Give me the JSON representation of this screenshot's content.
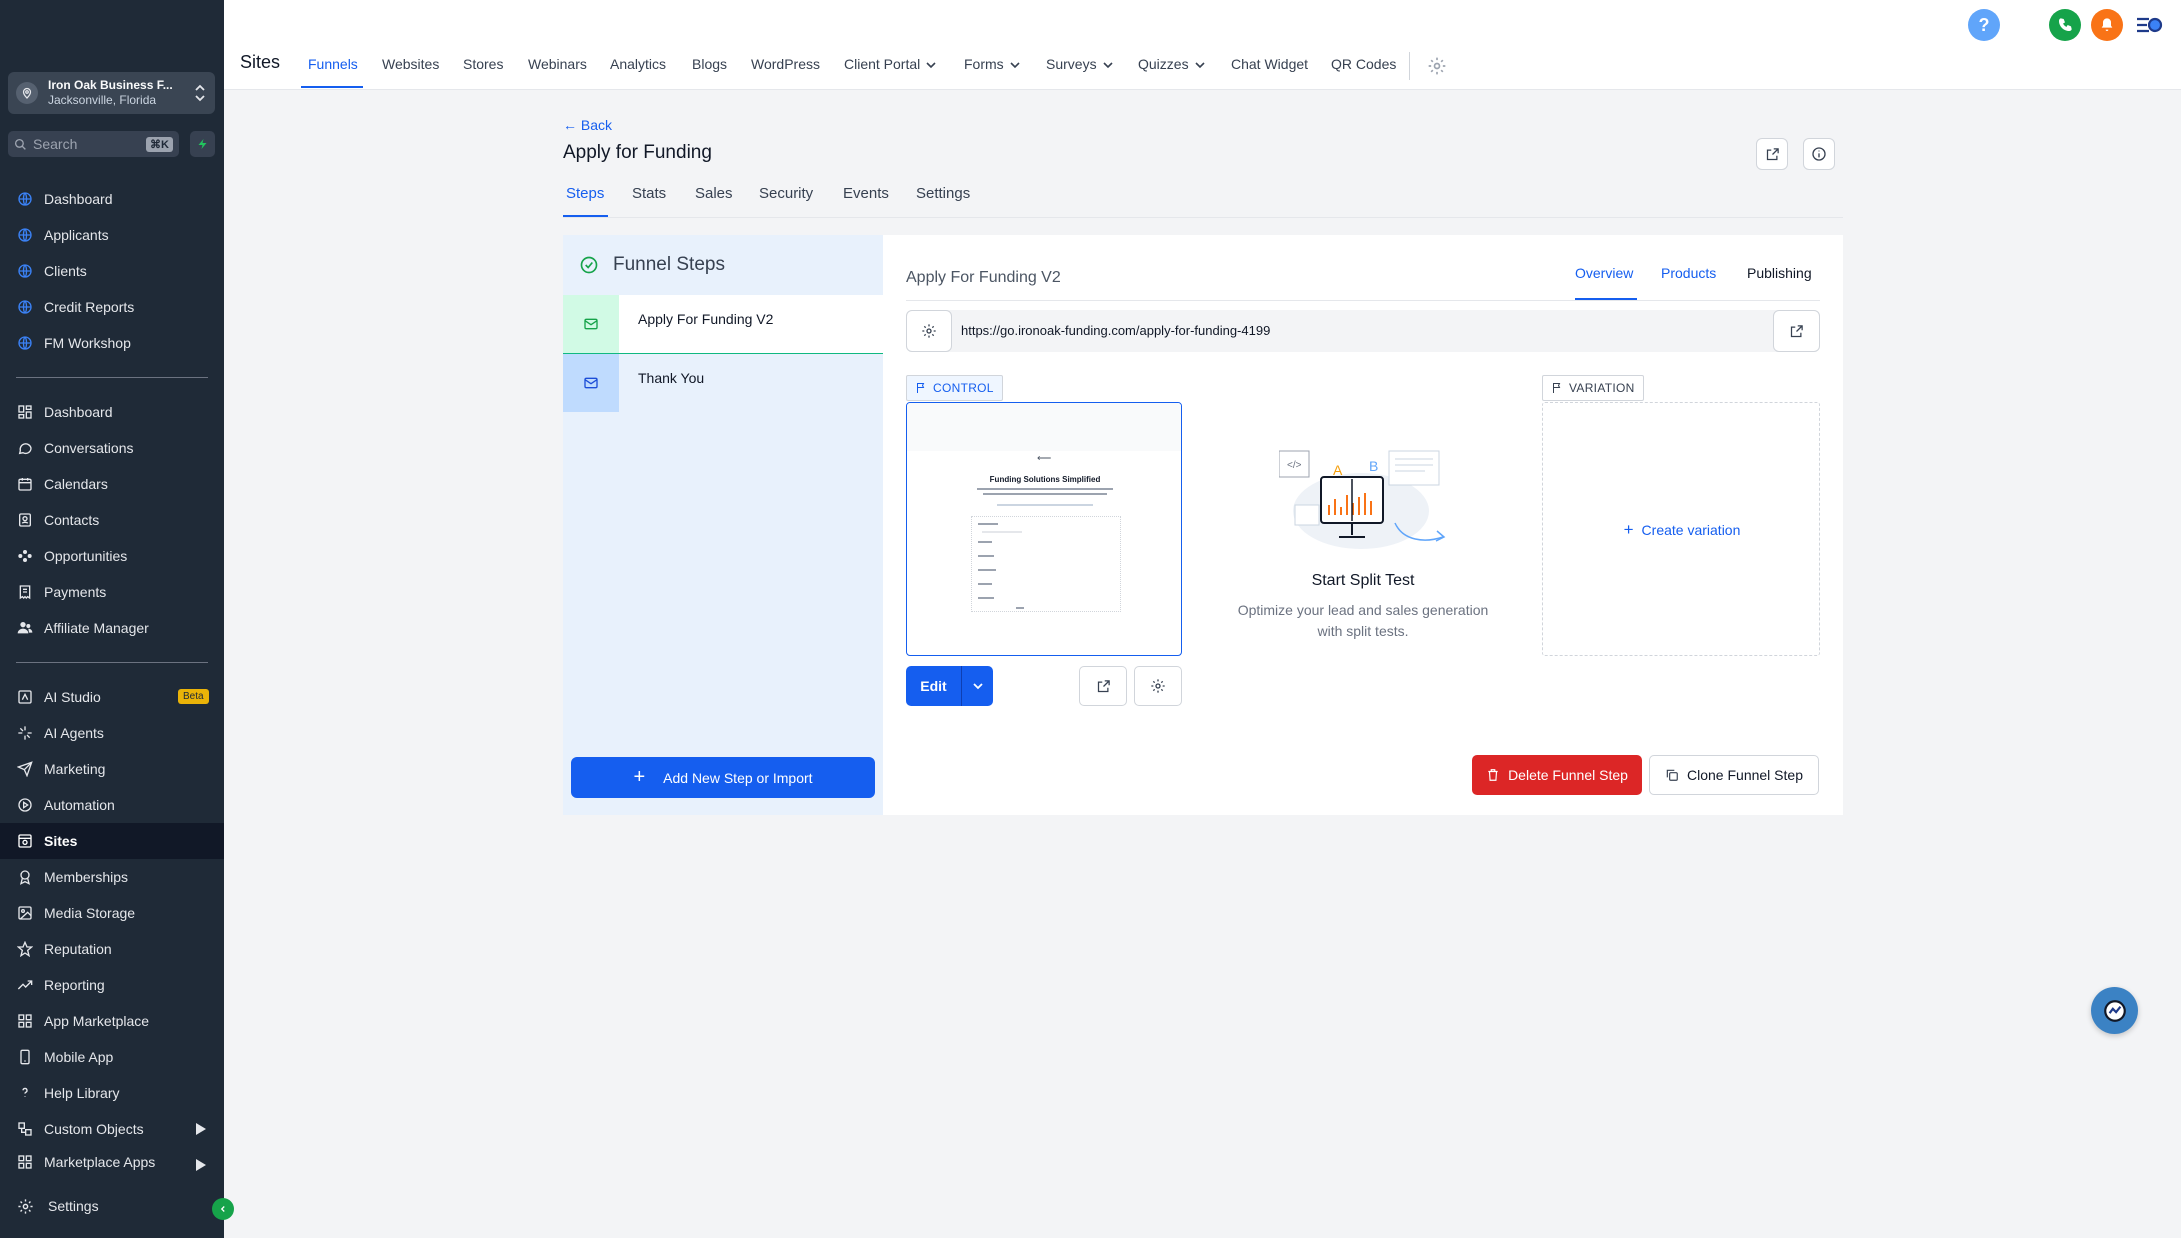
{
  "sidebar": {
    "account": {
      "name": "Iron Oak Business F...",
      "location": "Jacksonville, Florida"
    },
    "search": {
      "placeholder": "Search",
      "shortcut": "⌘K"
    },
    "pinned": [
      {
        "label": "Dashboard",
        "icon": "globe-icon"
      },
      {
        "label": "Applicants",
        "icon": "globe-icon"
      },
      {
        "label": "Clients",
        "icon": "globe-icon"
      },
      {
        "label": "Credit Reports",
        "icon": "globe-icon"
      },
      {
        "label": "FM Workshop",
        "icon": "globe-icon"
      }
    ],
    "main": [
      {
        "label": "Dashboard",
        "icon": "grid-icon"
      },
      {
        "label": "Conversations",
        "icon": "chat-bubble-icon"
      },
      {
        "label": "Calendars",
        "icon": "calendar-icon"
      },
      {
        "label": "Contacts",
        "icon": "contact-card-icon"
      },
      {
        "label": "Opportunities",
        "icon": "opportunities-icon"
      },
      {
        "label": "Payments",
        "icon": "receipt-icon"
      },
      {
        "label": "Affiliate Manager",
        "icon": "users-icon"
      }
    ],
    "tools": [
      {
        "label": "AI Studio",
        "icon": "ai-studio-icon"
      },
      {
        "label": "AI Agents",
        "icon": "sparkle-icon"
      },
      {
        "label": "Marketing",
        "icon": "send-icon"
      },
      {
        "label": "Automation",
        "icon": "automation-icon"
      },
      {
        "label": "Sites",
        "icon": "sites-icon"
      },
      {
        "label": "Memberships",
        "icon": "award-icon"
      },
      {
        "label": "Media Storage",
        "icon": "image-icon"
      },
      {
        "label": "Reputation",
        "icon": "star-icon"
      },
      {
        "label": "Reporting",
        "icon": "trending-icon"
      },
      {
        "label": "App Marketplace",
        "icon": "grid-icon"
      },
      {
        "label": "Mobile App",
        "icon": "mobile-icon"
      },
      {
        "label": "Help Library",
        "icon": "question-icon"
      },
      {
        "label": "Custom Objects",
        "icon": "objects-icon"
      },
      {
        "label": "Marketplace Apps",
        "icon": "grid-icon"
      }
    ],
    "beta_badge": "Beta",
    "settings_label": "Settings",
    "active_item": "Sites"
  },
  "topbar": {
    "title": "Sites",
    "tabs": [
      "Funnels",
      "Websites",
      "Stores",
      "Webinars",
      "Analytics",
      "Blogs",
      "WordPress",
      "Client Portal",
      "Forms",
      "Surveys",
      "Quizzes",
      "Chat Widget",
      "QR Codes"
    ],
    "active_tab": "Funnels",
    "help_glyph": "?"
  },
  "page": {
    "back_label": "Back",
    "title": "Apply for Funding",
    "tabs": [
      "Steps",
      "Stats",
      "Sales",
      "Security",
      "Events",
      "Settings"
    ],
    "active_tab": "Steps"
  },
  "funnel_steps": {
    "heading": "Funnel Steps",
    "steps": [
      {
        "label": "Apply For Funding V2",
        "selected": true
      },
      {
        "label": "Thank You",
        "selected": false
      }
    ],
    "add_button": "Add New Step or Import"
  },
  "step_detail": {
    "title": "Apply For Funding V2",
    "tabs": [
      "Overview",
      "Products",
      "Publishing"
    ],
    "active_tab": "Overview",
    "url": "https://go.ironoak-funding.com/apply-for-funding-4199",
    "control_label": "CONTROL",
    "variation_label": "VARIATION",
    "preview_heading": "Funding Solutions Simplified",
    "edit_label": "Edit",
    "split_test_title": "Start Split Test",
    "split_test_desc": "Optimize your lead and sales generation with split tests.",
    "illustration_letters": {
      "a": "A",
      "b": "B"
    },
    "create_variation": "Create variation",
    "delete_button": "Delete Funnel Step",
    "clone_button": "Clone Funnel Step"
  },
  "colors": {
    "sidebar_bg": "#1f2a37",
    "accent": "#155eef",
    "danger": "#dc2626",
    "phone": "#16a34a",
    "bell": "#f97316"
  }
}
